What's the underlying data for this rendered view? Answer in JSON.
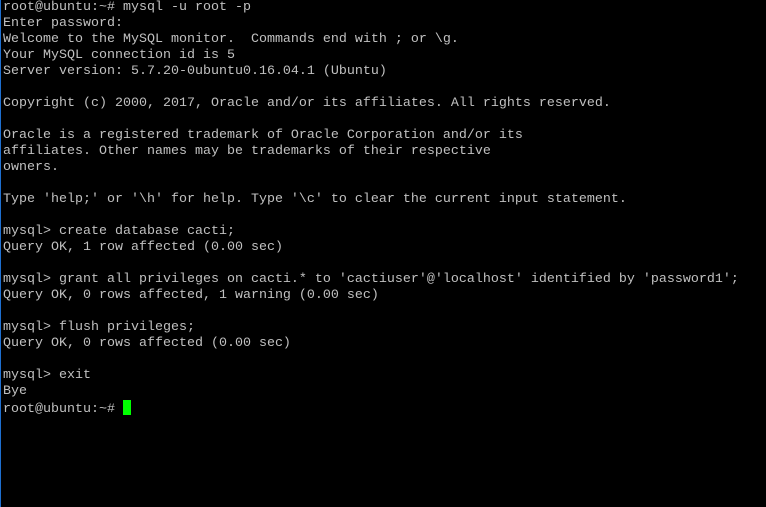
{
  "terminal": {
    "lines": [
      "root@ubuntu:~# mysql -u root -p",
      "Enter password:",
      "Welcome to the MySQL monitor.  Commands end with ; or \\g.",
      "Your MySQL connection id is 5",
      "Server version: 5.7.20-0ubuntu0.16.04.1 (Ubuntu)",
      "",
      "Copyright (c) 2000, 2017, Oracle and/or its affiliates. All rights reserved.",
      "",
      "Oracle is a registered trademark of Oracle Corporation and/or its",
      "affiliates. Other names may be trademarks of their respective",
      "owners.",
      "",
      "Type 'help;' or '\\h' for help. Type '\\c' to clear the current input statement.",
      "",
      "mysql> create database cacti;",
      "Query OK, 1 row affected (0.00 sec)",
      "",
      "mysql> grant all privileges on cacti.* to 'cactiuser'@'localhost' identified by 'password1';",
      "Query OK, 0 rows affected, 1 warning (0.00 sec)",
      "",
      "mysql> flush privileges;",
      "Query OK, 0 rows affected (0.00 sec)",
      "",
      "mysql> exit",
      "Bye"
    ],
    "prompt": "root@ubuntu:~# ",
    "cursor_color": "#00ff00",
    "text_color": "#c0c0c0",
    "background_color": "#000000"
  }
}
